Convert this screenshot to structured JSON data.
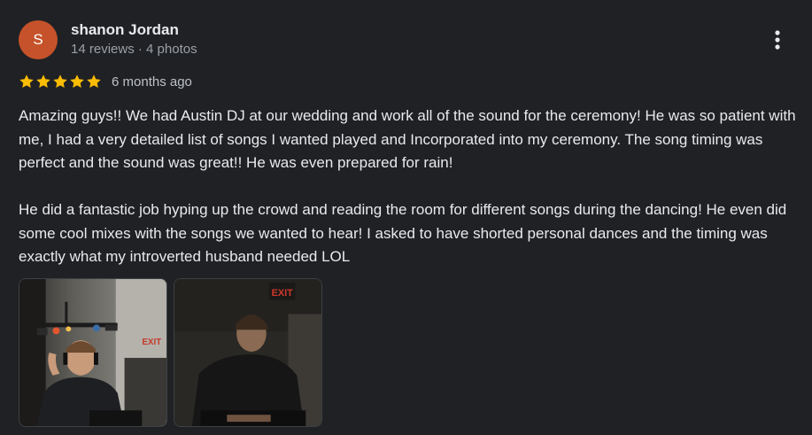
{
  "colors": {
    "avatar_bg": "#c5522a",
    "star": "#fbbc04",
    "background": "#202124"
  },
  "reviewer": {
    "initial": "S",
    "name": "shanon Jordan",
    "meta": "14 reviews · 4 photos"
  },
  "review": {
    "rating": 5,
    "rating_max": 5,
    "date": "6 months ago",
    "paragraphs": [
      "Amazing guys!! We had Austin DJ at our wedding and work all of the sound for the ceremony! He was so patient with me, I had a very detailed list of songs I wanted played and Incorporated into my ceremony. The song timing was perfect and the sound was great!! He was even prepared for rain!",
      "He did a fantastic job hyping up the crowd and reading the room for different songs during the dancing! He even did some cool mixes with the songs we wanted to hear! I asked to have shorted personal dances and the timing was exactly what my introverted husband needed LOL"
    ]
  },
  "photos": [
    {
      "exit_sign": "EXIT"
    },
    {
      "exit_sign": "EXIT"
    }
  ],
  "icons": {
    "more": "more-vert-icon",
    "star": "star-icon"
  }
}
